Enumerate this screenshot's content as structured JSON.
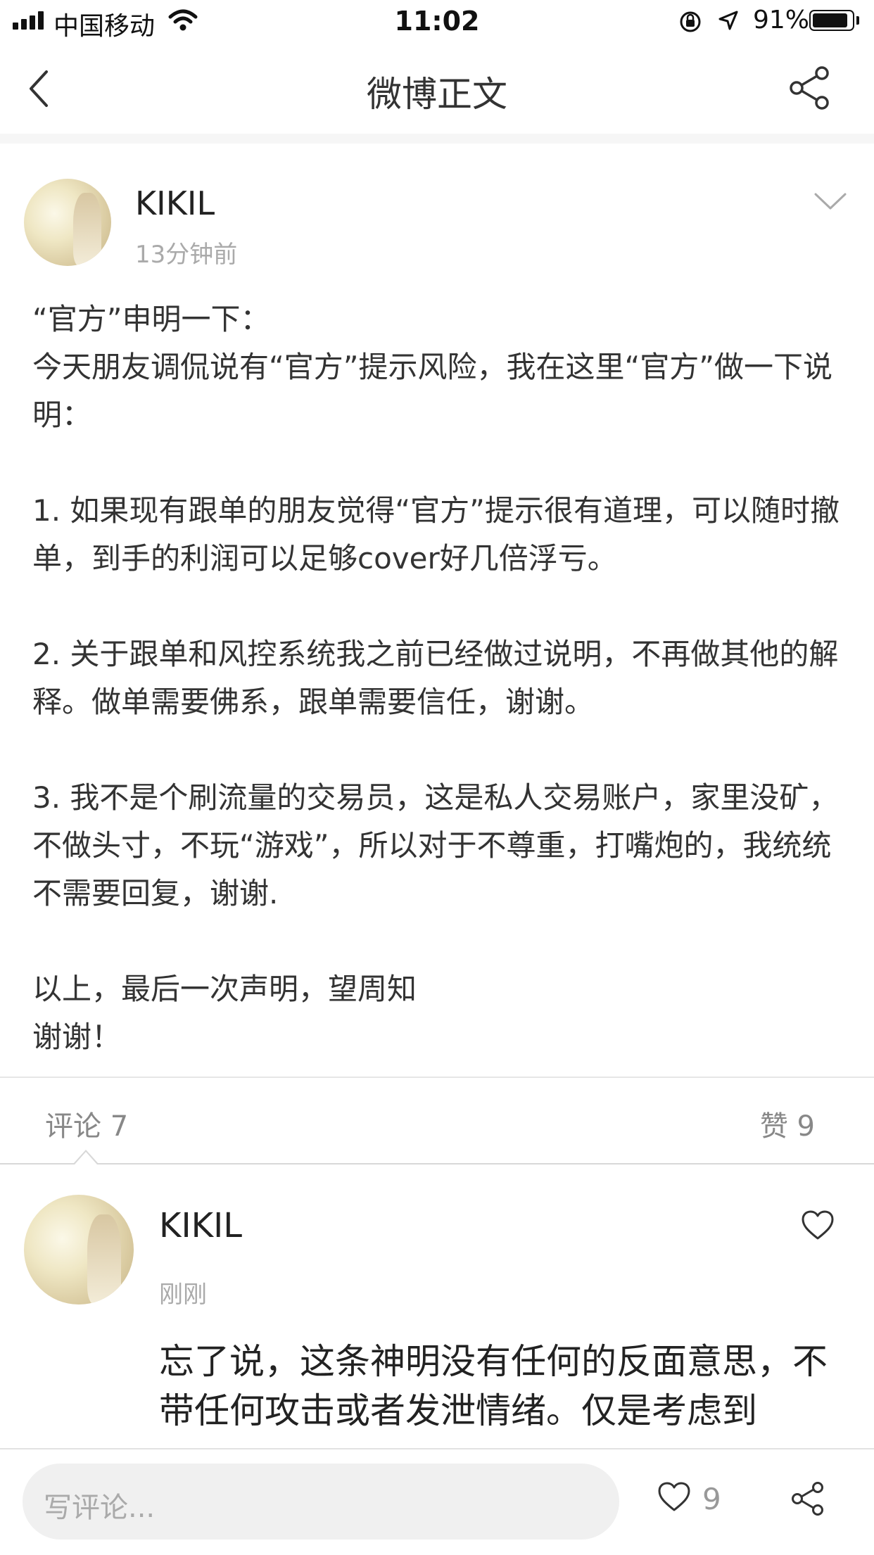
{
  "status_bar": {
    "carrier": "中国移动",
    "time": "11:02",
    "battery": "91%",
    "battery_level": 0.91
  },
  "nav": {
    "title": "微博正文"
  },
  "post": {
    "author": "KIKIL",
    "time": "13分钟前",
    "paragraphs": [
      "“官方”申明一下：",
      "今天朋友调侃说有“官方”提示风险，我在这里“官方”做一下说明：",
      "",
      "1. 如果现有跟单的朋友觉得“官方”提示很有道理，可以随时撤单，到手的利润可以足够cover好几倍浮亏。",
      "",
      "2. 关于跟单和风控系统我之前已经做过说明，不再做其他的解释。做单需要佛系，跟单需要信任，谢谢。",
      "",
      "3. 我不是个刷流量的交易员，这是私人交易账户，家里没矿，不做头寸，不玩“游戏”，所以对于不尊重，打嘴炮的，我统统不需要回复，谢谢.",
      "",
      "以上，最后一次声明，望周知",
      "谢谢！"
    ]
  },
  "tabs": {
    "comments": "评论 7",
    "likes": "赞 9"
  },
  "comment": {
    "author": "KIKIL",
    "time": "刚刚",
    "text": "忘了说，这条神明没有任何的反面意思，不带任何攻击或者发泄情绪。仅是考虑到"
  },
  "bottom_bar": {
    "input_placeholder": "写评论...",
    "like_count": "9"
  }
}
